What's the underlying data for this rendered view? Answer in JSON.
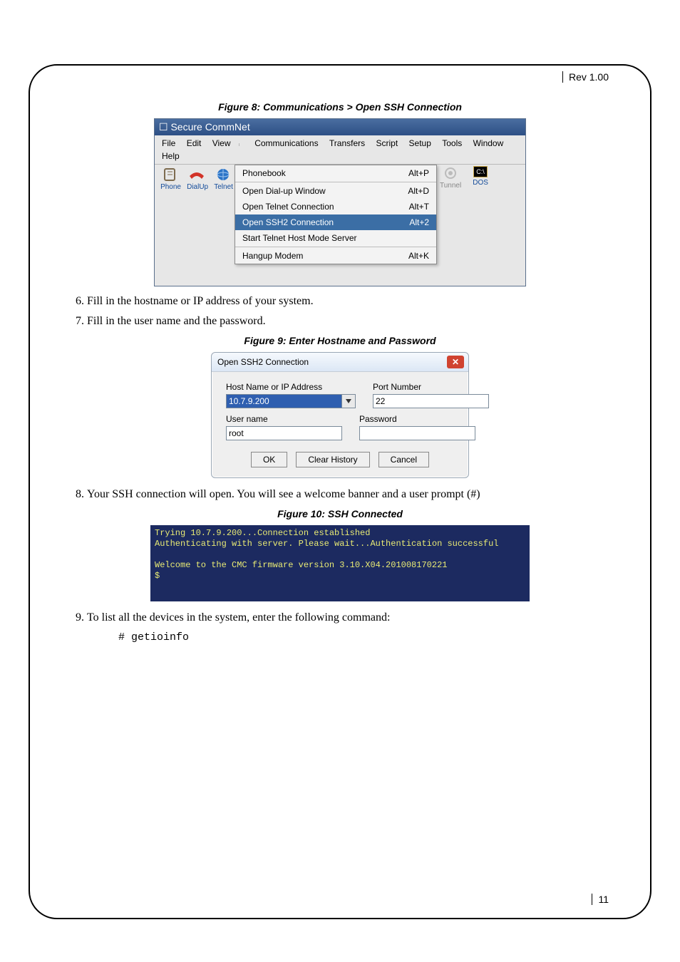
{
  "header": {
    "rev": "Rev 1.00"
  },
  "footer": {
    "page": "11"
  },
  "fig8": {
    "caption": "Figure 8: Communications > Open SSH Connection",
    "title": "Secure CommNet",
    "menubar": [
      "File",
      "Edit",
      "View",
      "Communications",
      "Transfers",
      "Script",
      "Setup",
      "Tools",
      "Window",
      "Help"
    ],
    "toolbar_left_labels": [
      "Phone",
      "DialUp",
      "Telnet"
    ],
    "dropdown": [
      {
        "label": "Phonebook",
        "shortcut": "Alt+P"
      },
      {
        "label": "Open Dial-up Window",
        "shortcut": "Alt+D"
      },
      {
        "label": "Open Telnet Connection",
        "shortcut": "Alt+T"
      },
      {
        "label": "Open SSH2 Connection",
        "shortcut": "Alt+2",
        "selected": true
      },
      {
        "label": "Start Telnet Host Mode Server",
        "shortcut": ""
      },
      {
        "label": "Hangup Modem",
        "shortcut": "Alt+K"
      }
    ],
    "toolbar_right": [
      {
        "label": "Tunnel",
        "active": false
      },
      {
        "label": "DOS",
        "active": true,
        "badge": "C:\\"
      }
    ]
  },
  "steps_a": {
    "s6": "Fill in the hostname or IP address of your system.",
    "s7": "Fill in the user name and the password."
  },
  "fig9": {
    "caption": "Figure 9: Enter Hostname and Password",
    "title": "Open SSH2 Connection",
    "labels": {
      "host": "Host Name or IP Address",
      "port": "Port Number",
      "user": "User name",
      "pass": "Password"
    },
    "values": {
      "host": "10.7.9.200",
      "port": "22",
      "user": "root",
      "pass": ""
    },
    "buttons": {
      "ok": "OK",
      "clear": "Clear History",
      "cancel": "Cancel"
    }
  },
  "steps_b": {
    "s8": "Your SSH connection will open. You will see a welcome banner and a user prompt (#)"
  },
  "fig10": {
    "caption": "Figure 10: SSH Connected",
    "lines": [
      "Trying 10.7.9.200...Connection established",
      "Authenticating with server. Please wait...Authentication successful",
      "",
      "Welcome to the CMC firmware version 3.10.X04.201008170221",
      "$"
    ]
  },
  "steps_c": {
    "s9": "To list all the devices in the system, enter the following command:",
    "code": "# getioinfo"
  }
}
